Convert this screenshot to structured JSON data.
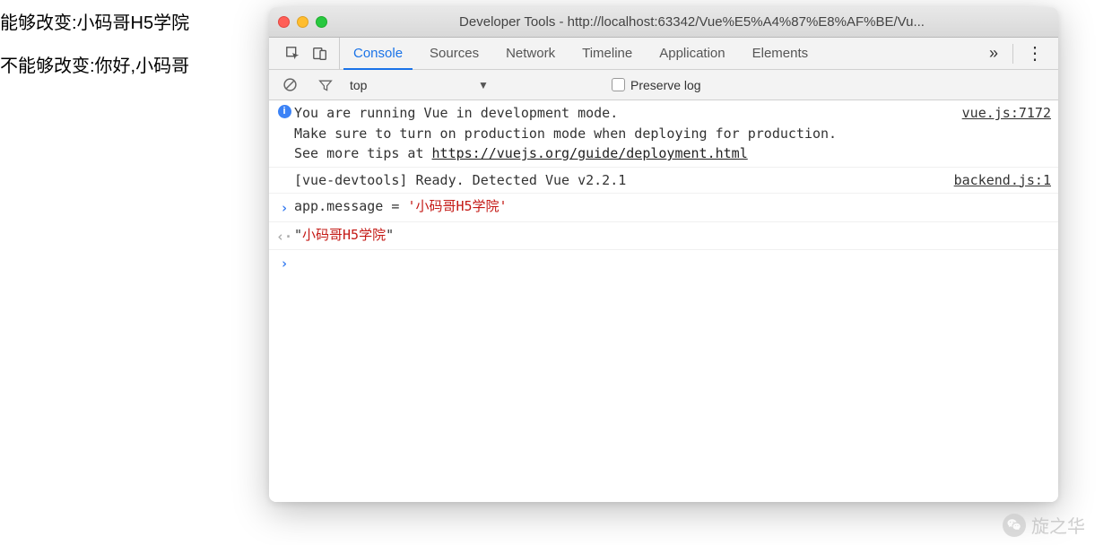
{
  "page": {
    "line1": "能够改变:小码哥H5学院",
    "line2": "不能够改变:你好,小码哥"
  },
  "titlebar": {
    "title": "Developer Tools - http://localhost:63342/Vue%E5%A4%87%E8%AF%BE/Vu..."
  },
  "tabs": {
    "items": [
      "Console",
      "Sources",
      "Network",
      "Timeline",
      "Application",
      "Elements"
    ],
    "active": 0,
    "overflow": "»",
    "menu": "⋮"
  },
  "filter": {
    "context": "top",
    "preserve_label": "Preserve log"
  },
  "console": {
    "rows": [
      {
        "type": "info",
        "text_pre": "You are running Vue in development mode.\nMake sure to turn on production mode when deploying for production.\nSee more tips at ",
        "link": "https://vuejs.org/guide/deployment.html",
        "src": "vue.js:7172"
      },
      {
        "type": "log",
        "text": "[vue-devtools] Ready. Detected Vue v2.2.1",
        "src": "backend.js:1"
      },
      {
        "type": "input",
        "text_pre": "app.message = ",
        "str": "'小码哥H5学院'"
      },
      {
        "type": "output",
        "text_pre": "\"",
        "str_mid": "小码哥H5学院",
        "text_post": "\""
      }
    ]
  },
  "watermark": {
    "text": "旋之华"
  }
}
